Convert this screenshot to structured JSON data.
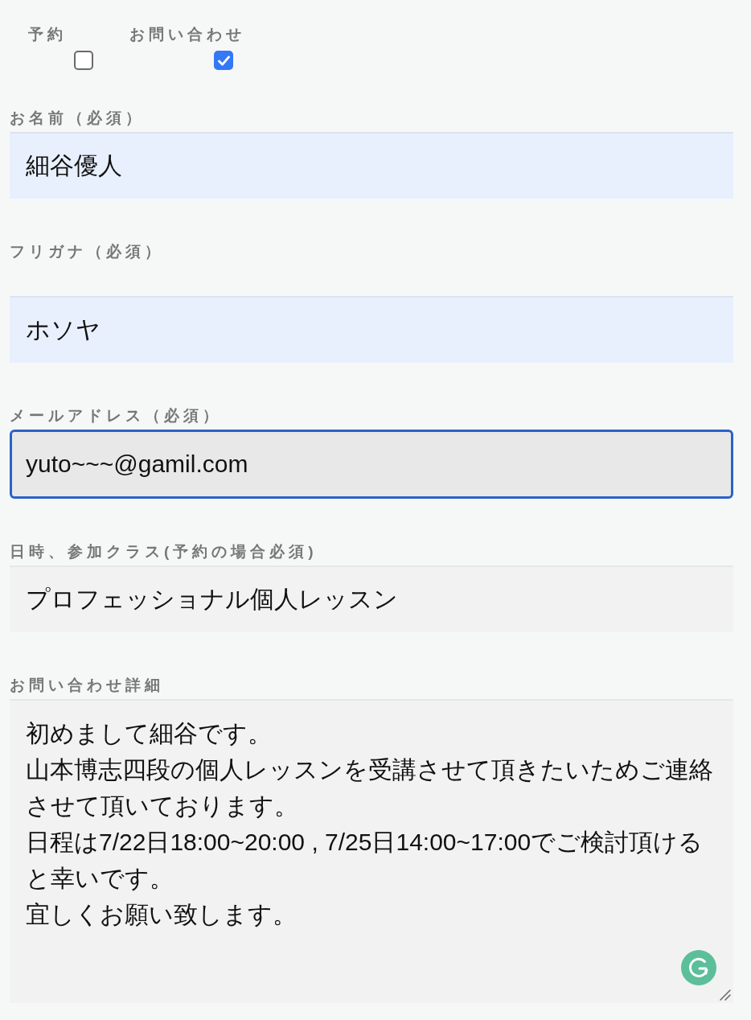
{
  "contact_type": [
    {
      "label": "予約",
      "checked": false
    },
    {
      "label": "お問い合わせ",
      "checked": true
    }
  ],
  "fields": [
    {
      "label": "お名前（必須）",
      "kind": "input",
      "value": "細谷優人",
      "autofilled": true,
      "focused": false
    },
    {
      "label": "フリガナ（必須）",
      "kind": "input",
      "value": "ホソヤ",
      "autofilled": true,
      "focused": false
    },
    {
      "label": "メールアドレス（必須）",
      "kind": "input",
      "value": "yuto~~~@gamil.com",
      "autofilled": false,
      "focused": true
    },
    {
      "label": "日時、参加クラス(予約の場合必須)",
      "kind": "input",
      "value": "プロフェッショナル個人レッスン",
      "autofilled": false,
      "focused": false
    },
    {
      "label": "お問い合わせ詳細",
      "kind": "textarea",
      "lines": [
        "初めまして細谷です。",
        "山本博志四段の個人レッスンを受講させて頂きたいためご連絡させて頂いております。",
        "日程は7/22日18:00~20:00 , 7/25日14:00~17:00でご検討頂けると幸いです。",
        "宜しくお願い致します。"
      ],
      "autofilled": false,
      "focused": false
    }
  ]
}
